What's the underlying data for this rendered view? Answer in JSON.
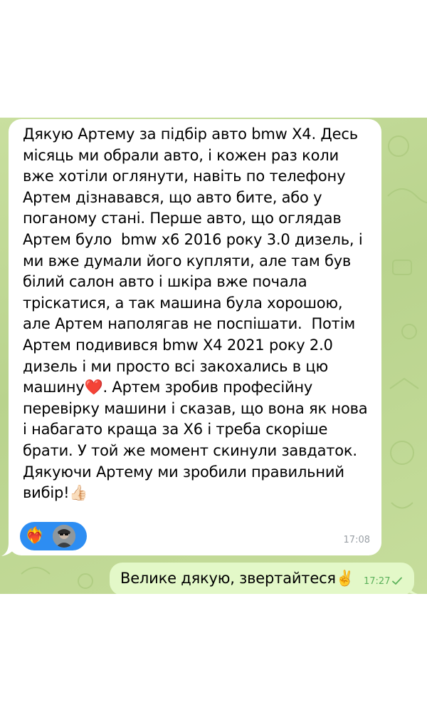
{
  "incoming": {
    "text": "Дякую Артему за підбір авто bmw X4. Десь\nмісяць ми обрали авто, і кожен раз коли\nвже хотіли оглянути, навіть по телефону\nАртем дізнавався, що авто бите, або у\nпоганому стані. Перше авто, що оглядав\nАртем було  bmw x6 2016 року 3.0 дизель, і\nми вже думали його купляти, але там був\nбілий салон авто і шкіра вже почала\nтріскатися, а так машина була хорошою,\nале Артем наполягав не поспішати.  Потім\nАртем подивився bmw X4 2021 року 2.0\nдизель і ми просто всі закохались в цю\nмашину❤️. Артем зробив професійну\nперевірку машини і сказав, що вона як нова\nі набагато краща за X6 і треба скоріше\nбрати. У той же момент скинули завдаток.\nДякуючи Артему ми зробили правильний\nвибір!👍🏻",
    "time": "17:08",
    "reaction_emoji": "❤️‍🔥"
  },
  "outgoing": {
    "text": "Велике дякую, звертайтеся✌️",
    "time": "17:27"
  },
  "colors": {
    "wallpaper": "#c3da98",
    "incoming_bubble": "#ffffff",
    "outgoing_bubble": "#e3f8c8",
    "reaction_pill": "#2d8df2",
    "time_outgoing": "#5bb15b",
    "time_incoming": "#9aa0a6"
  },
  "icons": {
    "read_status": "single-check-icon",
    "avatar": "user-avatar"
  }
}
